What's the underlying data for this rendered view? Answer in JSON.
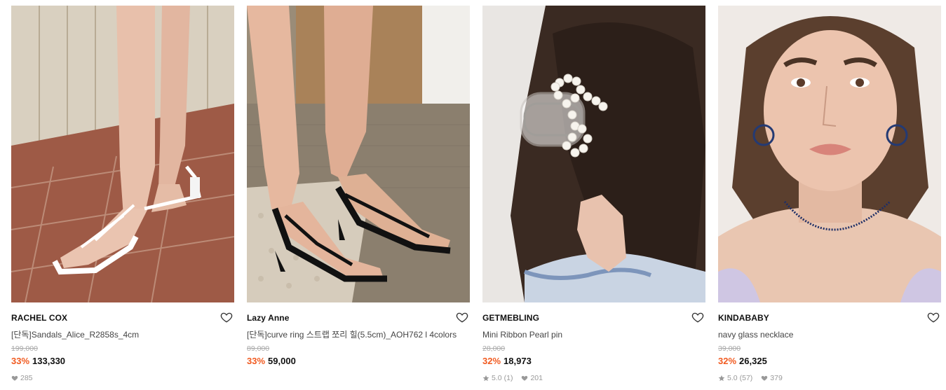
{
  "products": [
    {
      "brand": "RACHEL COX",
      "name": "[단독]Sandals_Alice_R2858s_4cm",
      "original_price": "199,000",
      "discount": "33%",
      "price": "133,330",
      "likes": "285",
      "image_icon": "white-strappy-sandals-photo"
    },
    {
      "brand": "Lazy Anne",
      "name": "[단독]curve ring 스트랩 쪼리 힐(5.5cm)_AOH762 l 4colors",
      "original_price": "89,000",
      "discount": "33%",
      "price": "59,000",
      "image_icon": "black-strappy-heels-photo"
    },
    {
      "brand": "GETMEBLING",
      "name": "Mini Ribbon Pearl pin",
      "original_price": "28,000",
      "discount": "32%",
      "price": "18,973",
      "rating": "5.0",
      "reviews": "(1)",
      "likes": "201",
      "image_icon": "pearl-ribbon-hair-claw-photo"
    },
    {
      "brand": "KINDABABY",
      "name": "navy glass necklace",
      "original_price": "39,000",
      "discount": "32%",
      "price": "26,325",
      "rating": "5.0",
      "reviews": "(57)",
      "likes": "379",
      "image_icon": "navy-bead-necklace-portrait-photo"
    }
  ],
  "colors": {
    "discount": "#f15b21",
    "price": "#111111",
    "muted": "#999999"
  }
}
